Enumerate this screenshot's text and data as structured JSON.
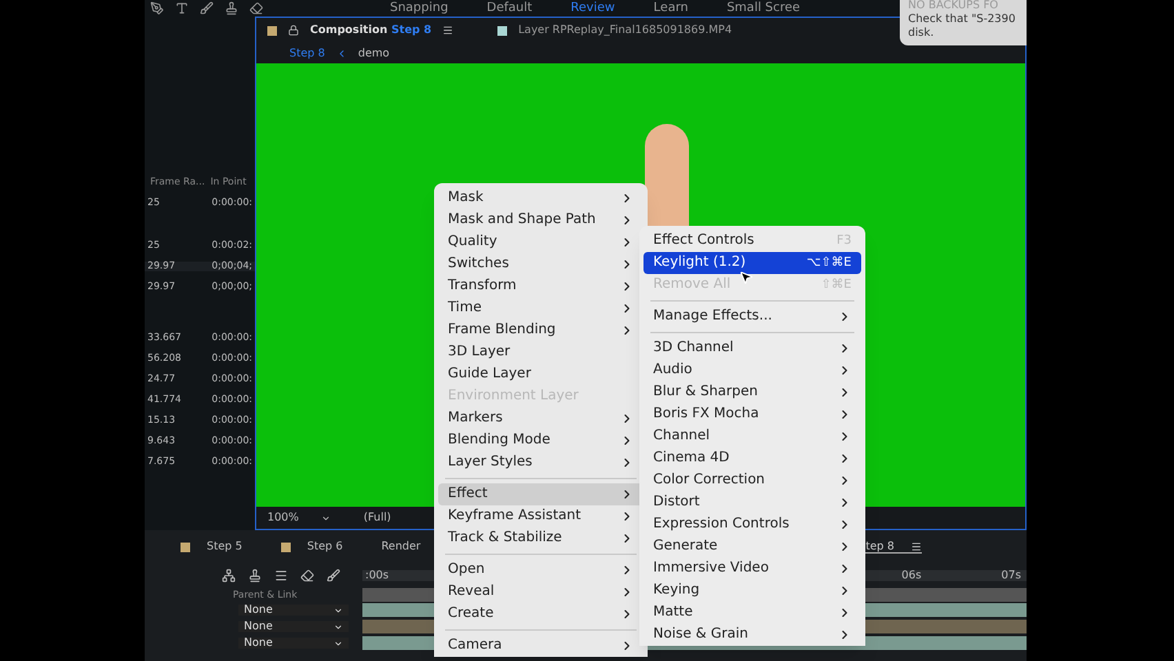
{
  "workspaces": [
    {
      "label": "Snapping",
      "selected": false
    },
    {
      "label": "Default",
      "selected": false
    },
    {
      "label": "Review",
      "selected": true
    },
    {
      "label": "Learn",
      "selected": false
    },
    {
      "label": "Small Scree",
      "selected": false
    }
  ],
  "notification": {
    "title": "NO BACKUPS FO",
    "message": "Check that \"S-2390",
    "message_2": "disk."
  },
  "project": {
    "columns": [
      "Frame Ra...",
      "In Point"
    ],
    "rows": [
      {
        "frame_rate": "25",
        "in_point": "0:00:00:"
      },
      {
        "frame_rate": "25",
        "in_point": "0:00:02:"
      },
      {
        "frame_rate": "29.97",
        "in_point": "0;00;04;"
      },
      {
        "frame_rate": "29.97",
        "in_point": "0;00;00;"
      },
      {
        "frame_rate": "33.667",
        "in_point": "0:00:00:"
      },
      {
        "frame_rate": "56.208",
        "in_point": "0:00:00:"
      },
      {
        "frame_rate": "24.77",
        "in_point": "0:00:00:"
      },
      {
        "frame_rate": "41.774",
        "in_point": "0:00:00:"
      },
      {
        "frame_rate": "15.13",
        "in_point": "0:00:00:"
      },
      {
        "frame_rate": "9.643",
        "in_point": "0:00:00:"
      },
      {
        "frame_rate": "7.675",
        "in_point": "0:00:00:"
      }
    ]
  },
  "composition": {
    "tab_label": "Composition",
    "tab_comp": "Step 8",
    "layer_tab": "Layer RPReplay_Final1685091869.MP4",
    "breadcrumb": [
      "Step 8",
      "demo"
    ],
    "zoom": "100%",
    "resolution": "(Full)"
  },
  "timeline": {
    "tabs": [
      {
        "label": "Step 5",
        "swatch": true,
        "selected": false
      },
      {
        "label": "Step 6",
        "swatch": true,
        "selected": false
      },
      {
        "label": "Render",
        "swatch": false,
        "selected": false
      },
      {
        "label": "tep 8",
        "swatch": false,
        "selected": true
      }
    ],
    "ruler": [
      ":00s",
      "06s",
      "07s"
    ],
    "parent_header": "Parent & Link",
    "parents": [
      "None",
      "None",
      "None"
    ]
  },
  "context_menu": [
    {
      "kind": "item",
      "label": "Mask",
      "submenu": true,
      "disabled": false,
      "selected": false
    },
    {
      "kind": "item",
      "label": "Mask and Shape Path",
      "submenu": true,
      "disabled": false,
      "selected": false
    },
    {
      "kind": "item",
      "label": "Quality",
      "submenu": true,
      "disabled": false,
      "selected": false
    },
    {
      "kind": "item",
      "label": "Switches",
      "submenu": true,
      "disabled": false,
      "selected": false
    },
    {
      "kind": "item",
      "label": "Transform",
      "submenu": true,
      "disabled": false,
      "selected": false
    },
    {
      "kind": "item",
      "label": "Time",
      "submenu": true,
      "disabled": false,
      "selected": false
    },
    {
      "kind": "item",
      "label": "Frame Blending",
      "submenu": true,
      "disabled": false,
      "selected": false
    },
    {
      "kind": "item",
      "label": "3D Layer",
      "submenu": false,
      "disabled": false,
      "selected": false
    },
    {
      "kind": "item",
      "label": "Guide Layer",
      "submenu": false,
      "disabled": false,
      "selected": false
    },
    {
      "kind": "item",
      "label": "Environment Layer",
      "submenu": false,
      "disabled": true,
      "selected": false
    },
    {
      "kind": "item",
      "label": "Markers",
      "submenu": true,
      "disabled": false,
      "selected": false
    },
    {
      "kind": "item",
      "label": "Blending Mode",
      "submenu": true,
      "disabled": false,
      "selected": false
    },
    {
      "kind": "item",
      "label": "Layer Styles",
      "submenu": true,
      "disabled": false,
      "selected": false
    },
    {
      "kind": "separator"
    },
    {
      "kind": "item",
      "label": "Effect",
      "submenu": true,
      "disabled": false,
      "selected": true
    },
    {
      "kind": "item",
      "label": "Keyframe Assistant",
      "submenu": true,
      "disabled": false,
      "selected": false
    },
    {
      "kind": "item",
      "label": "Track & Stabilize",
      "submenu": true,
      "disabled": false,
      "selected": false
    },
    {
      "kind": "separator"
    },
    {
      "kind": "item",
      "label": "Open",
      "submenu": true,
      "disabled": false,
      "selected": false
    },
    {
      "kind": "item",
      "label": "Reveal",
      "submenu": true,
      "disabled": false,
      "selected": false
    },
    {
      "kind": "item",
      "label": "Create",
      "submenu": true,
      "disabled": false,
      "selected": false
    },
    {
      "kind": "separator"
    },
    {
      "kind": "item",
      "label": "Camera",
      "submenu": true,
      "disabled": false,
      "selected": false
    }
  ],
  "effect_menu": [
    {
      "kind": "item",
      "label": "Effect Controls",
      "shortcut": "F3",
      "submenu": false,
      "disabled": false,
      "selected": false
    },
    {
      "kind": "item",
      "label": "Keylight (1.2)",
      "shortcut": "⌥⇧⌘E",
      "submenu": false,
      "disabled": false,
      "selected": true
    },
    {
      "kind": "item",
      "label": "Remove All",
      "shortcut": "⇧⌘E",
      "submenu": false,
      "disabled": true,
      "selected": false
    },
    {
      "kind": "separator"
    },
    {
      "kind": "item",
      "label": "Manage Effects...",
      "submenu": true,
      "disabled": false,
      "selected": false
    },
    {
      "kind": "separator"
    },
    {
      "kind": "item",
      "label": "3D Channel",
      "submenu": true,
      "disabled": false,
      "selected": false
    },
    {
      "kind": "item",
      "label": "Audio",
      "submenu": true,
      "disabled": false,
      "selected": false
    },
    {
      "kind": "item",
      "label": "Blur & Sharpen",
      "submenu": true,
      "disabled": false,
      "selected": false
    },
    {
      "kind": "item",
      "label": "Boris FX Mocha",
      "submenu": true,
      "disabled": false,
      "selected": false
    },
    {
      "kind": "item",
      "label": "Channel",
      "submenu": true,
      "disabled": false,
      "selected": false
    },
    {
      "kind": "item",
      "label": "Cinema 4D",
      "submenu": true,
      "disabled": false,
      "selected": false
    },
    {
      "kind": "item",
      "label": "Color Correction",
      "submenu": true,
      "disabled": false,
      "selected": false
    },
    {
      "kind": "item",
      "label": "Distort",
      "submenu": true,
      "disabled": false,
      "selected": false
    },
    {
      "kind": "item",
      "label": "Expression Controls",
      "submenu": true,
      "disabled": false,
      "selected": false
    },
    {
      "kind": "item",
      "label": "Generate",
      "submenu": true,
      "disabled": false,
      "selected": false
    },
    {
      "kind": "item",
      "label": "Immersive Video",
      "submenu": true,
      "disabled": false,
      "selected": false
    },
    {
      "kind": "item",
      "label": "Keying",
      "submenu": true,
      "disabled": false,
      "selected": false
    },
    {
      "kind": "item",
      "label": "Matte",
      "submenu": true,
      "disabled": false,
      "selected": false
    },
    {
      "kind": "item",
      "label": "Noise & Grain",
      "submenu": true,
      "disabled": false,
      "selected": false
    }
  ]
}
